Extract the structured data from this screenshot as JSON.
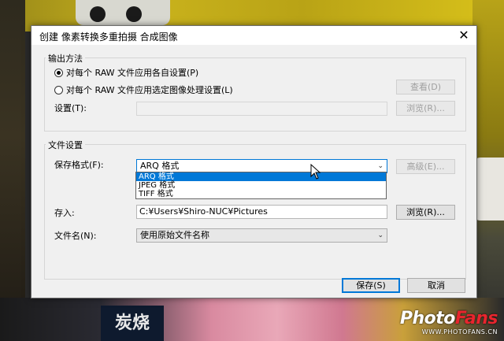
{
  "dialog": {
    "title": "创建 像素转换多重拍摄 合成图像",
    "output_method": {
      "label": "输出方法",
      "options": [
        {
          "label": "对每个 RAW 文件应用各自设置(P)",
          "selected": true
        },
        {
          "label": "对每个 RAW 文件应用选定图像处理设置(L)",
          "selected": false
        }
      ],
      "view_button": "查看(D)",
      "settings_label": "设置(T):",
      "settings_value": "",
      "browse_button": "浏览(R)..."
    },
    "file_settings": {
      "label": "文件设置",
      "save_format_label": "保存格式(F):",
      "save_format_value": "ARQ 格式",
      "format_options": [
        "ARQ 格式",
        "JPEG 格式",
        "TIFF 格式"
      ],
      "advanced_button": "高级(E)...",
      "save_to_label": "存入:",
      "save_to_value": "C:¥Users¥Shiro-NUC¥Pictures",
      "browse_button": "浏览(R)...",
      "filename_label": "文件名(N):",
      "filename_value": "使用原始文件名称"
    },
    "save_button": "保存(S)",
    "cancel_button": "取消"
  },
  "watermark": {
    "logo_left": "Photo",
    "logo_right": "Fans",
    "url": "WWW.PHOTOFANS.CN"
  },
  "background": {
    "sign_text": "炭烧"
  }
}
